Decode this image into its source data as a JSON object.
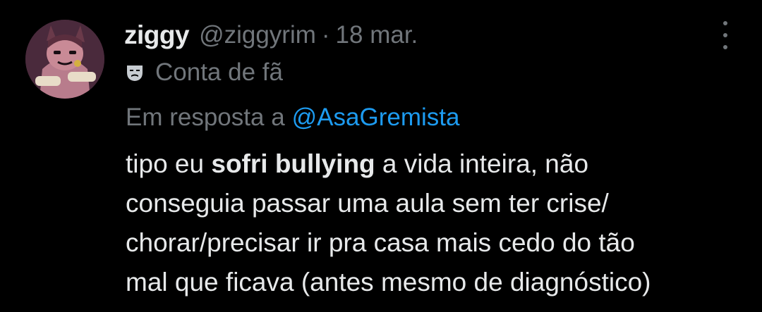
{
  "author": {
    "display_name": "ziggy",
    "handle": "@ziggyrim",
    "separator": "·",
    "date": "18 mar.",
    "avatar_icon": "cartoon-character-avatar"
  },
  "label": {
    "icon": "theater-mask-icon",
    "text": "Conta de fã"
  },
  "reply": {
    "prefix": "Em resposta a",
    "mention": "@AsaGremista"
  },
  "tweet": {
    "line1_before": "tipo eu ",
    "line1_bold": "sofri bullying",
    "line1_after": " a vida inteira, não",
    "line2": "conseguia passar uma aula sem ter crise/",
    "line3": "chorar/precisar ir pra casa mais cedo do tão",
    "line4": "mal que ficava (antes mesmo de diagnóstico)"
  },
  "colors": {
    "background": "#000000",
    "text": "#e7e9ea",
    "secondary": "#71767b",
    "accent": "#1d9bf0"
  }
}
